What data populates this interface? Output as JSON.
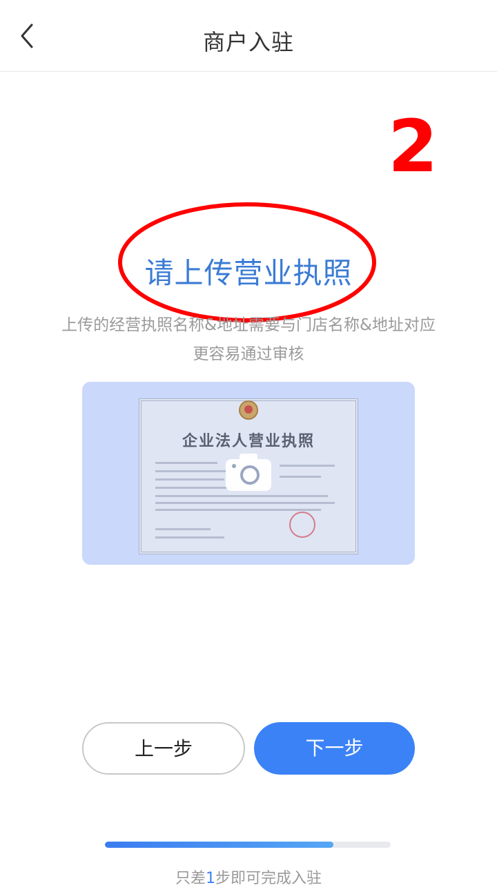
{
  "header": {
    "title": "商户入驻",
    "back_icon": "chevron-left-icon"
  },
  "annotation": {
    "step_number": "2",
    "ellipse_color": "#ff0000"
  },
  "upload": {
    "title": "请上传营业执照",
    "desc_line1": "上传的经营执照名称&地址需要与门店名称&地址对应",
    "desc_line2": "更容易通过审核",
    "sample_title": "企业法人营业执照",
    "camera_icon": "camera-icon"
  },
  "buttons": {
    "prev_label": "上一步",
    "next_label": "下一步"
  },
  "progress": {
    "value": 0.8,
    "text_prefix": "只差",
    "text_number": "1",
    "text_suffix": "步即可完成入驻"
  },
  "colors": {
    "accent": "#3b82f6",
    "title_blue": "#3a7bd5",
    "card_bg": "#c9d8fb"
  }
}
